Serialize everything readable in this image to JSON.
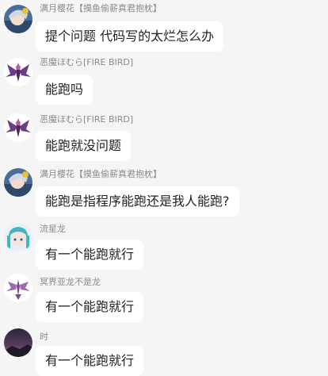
{
  "messages": [
    {
      "sender": "满月樱花【摸鱼偷薪真君抱枕】",
      "text": "提个问题 代码写的太烂怎么办"
    },
    {
      "sender": "恶魔ほむら[FIRE BIRD]",
      "text": "能跑吗"
    },
    {
      "sender": "恶魔ほむら[FIRE BIRD]",
      "text": "能跑就没问题"
    },
    {
      "sender": "满月樱花【摸鱼偷薪真君抱枕】",
      "text": "能跑是指程序能跑还是我人能跑?"
    },
    {
      "sender": "流星龙",
      "text": "有一个能跑就行"
    },
    {
      "sender": "冥界亚龙不是龙",
      "text": "有一个能跑就行"
    },
    {
      "sender": "时",
      "text": "有一个能跑就行"
    }
  ]
}
